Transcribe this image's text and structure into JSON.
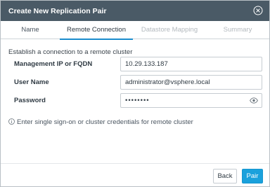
{
  "dialog": {
    "title": "Create New Replication Pair",
    "close_icon": "close-circle-icon"
  },
  "tabs": [
    {
      "label": "Name",
      "state": "completed"
    },
    {
      "label": "Remote Connection",
      "state": "active"
    },
    {
      "label": "Datastore Mapping",
      "state": "disabled"
    },
    {
      "label": "Summary",
      "state": "disabled"
    }
  ],
  "intro": "Establish a connection to a remote cluster",
  "form": {
    "management_ip": {
      "label": "Management IP or FQDN",
      "value": "10.29.133.187"
    },
    "user_name": {
      "label": "User Name",
      "value": "administrator@vsphere.local"
    },
    "password": {
      "label": "Password",
      "value": "••••••••",
      "reveal_icon": "eye-icon"
    }
  },
  "hint": {
    "icon": "info-icon",
    "text": "Enter single sign-on or cluster credentials for remote cluster"
  },
  "footer": {
    "back_label": "Back",
    "pair_label": "Pair"
  },
  "colors": {
    "titlebar": "#4a5a66",
    "accent": "#1a8ccd",
    "primary_button": "#1aa1dc"
  }
}
